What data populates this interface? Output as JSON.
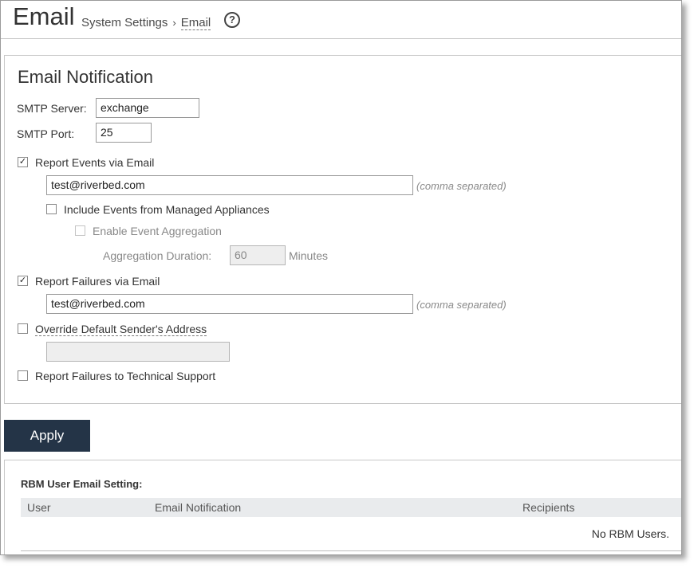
{
  "header": {
    "title": "Email",
    "breadcrumb": {
      "parent": "System Settings",
      "separator": "›",
      "current": "Email"
    },
    "help_icon": "?"
  },
  "email_notification": {
    "title": "Email Notification",
    "smtp_server": {
      "label": "SMTP Server:",
      "value": "exchange"
    },
    "smtp_port": {
      "label": "SMTP Port:",
      "value": "25"
    },
    "report_events": {
      "label": "Report Events via Email",
      "checked": true,
      "recipients": "test@riverbed.com",
      "hint": "(comma separated)"
    },
    "include_managed": {
      "label": "Include Events from Managed Appliances",
      "checked": false
    },
    "enable_aggregation": {
      "label": "Enable Event Aggregation",
      "checked": false,
      "disabled": true
    },
    "aggregation_duration": {
      "label": "Aggregation Duration:",
      "value": "60",
      "unit": "Minutes"
    },
    "report_failures": {
      "label": "Report Failures via Email",
      "checked": true,
      "recipients": "test@riverbed.com",
      "hint": "(comma separated)"
    },
    "override_sender": {
      "label": "Override Default Sender's Address",
      "checked": false,
      "value": ""
    },
    "report_tech_support": {
      "label": "Report Failures to Technical Support",
      "checked": false
    }
  },
  "actions": {
    "apply_label": "Apply"
  },
  "rbm": {
    "title": "RBM User Email Setting:",
    "columns": [
      "User",
      "Email Notification",
      "Recipients"
    ],
    "empty_text": "No RBM Users."
  },
  "colors": {
    "apply_button": "#243447",
    "table_header": "#e9ebed"
  },
  "icons": {
    "help": "help-icon",
    "checkmark": "✓"
  }
}
